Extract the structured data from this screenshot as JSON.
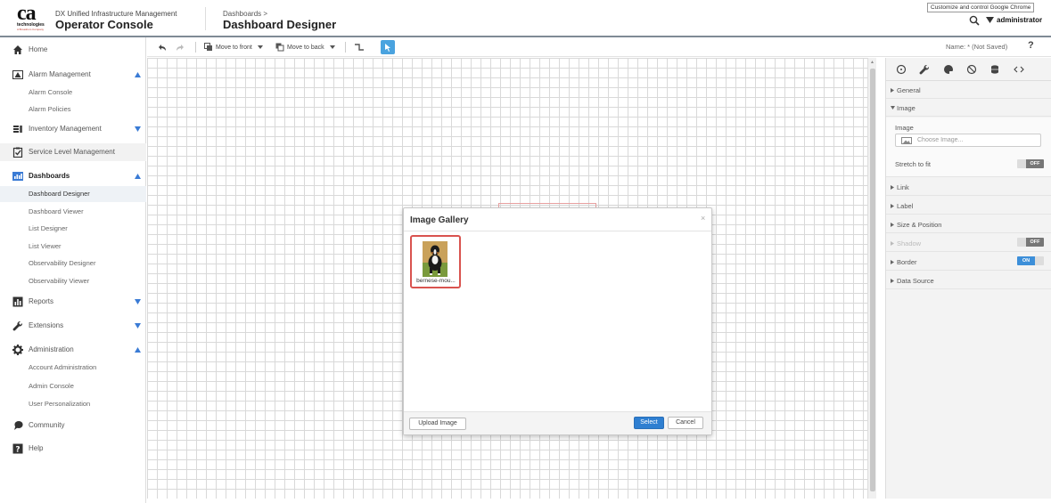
{
  "header": {
    "logo_text": "ca",
    "logo_tagline": "technologies",
    "logo_sub": "A Broadcom Company",
    "product_name": "DX Unified Infrastructure Management",
    "console_name": "Operator Console",
    "breadcrumb": "Dashboards  >",
    "page_title": "Dashboard Designer",
    "tooltip": "Customize and control Google Chrome",
    "username": "administrator"
  },
  "sidebar": {
    "home": "Home",
    "alarm_management": "Alarm Management",
    "alarm_console": "Alarm Console",
    "alarm_policies": "Alarm Policies",
    "inventory_management": "Inventory Management",
    "service_level_management": "Service Level Management",
    "dashboards": "Dashboards",
    "dashboard_designer": "Dashboard Designer",
    "dashboard_viewer": "Dashboard Viewer",
    "list_designer": "List Designer",
    "list_viewer": "List Viewer",
    "observability_designer": "Observability Designer",
    "observability_viewer": "Observability Viewer",
    "reports": "Reports",
    "extensions": "Extensions",
    "administration": "Administration",
    "account_administration": "Account Administration",
    "admin_console": "Admin Console",
    "user_personalization": "User Personalization",
    "community": "Community",
    "help": "Help"
  },
  "toolbar": {
    "move_to_front": "Move to front",
    "move_to_back": "Move to back",
    "name_label": "Name:  * (Not Saved)",
    "help": "?"
  },
  "panel": {
    "general": "General",
    "image": "Image",
    "image_field_label": "Image",
    "choose_placeholder": "Choose Image...",
    "stretch_to_fit": "Stretch to fit",
    "stretch_state": "OFF",
    "link": "Link",
    "label": "Label",
    "size_position": "Size & Position",
    "shadow": "Shadow",
    "shadow_state": "OFF",
    "border": "Border",
    "border_state": "ON",
    "data_source": "Data Source"
  },
  "modal": {
    "title": "Image Gallery",
    "close": "×",
    "image_name": "bernese-mou...",
    "upload_button": "Upload Image",
    "select_button": "Select",
    "cancel_button": "Cancel"
  }
}
